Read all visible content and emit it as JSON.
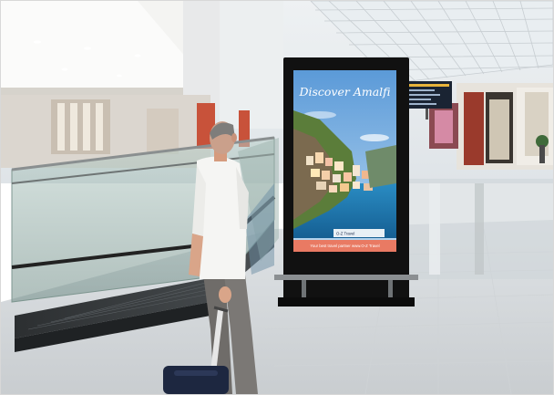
{
  "billboard": {
    "headline": "Discover Amalfi",
    "brand": "O-Z Travel",
    "tagline": "Your best travel partner www.O-Z Travel"
  },
  "colors": {
    "sky": "#6aa6e0",
    "sea": "#1f7fb8",
    "footer_band": "#e97a63",
    "kiosk_frame": "#111111"
  },
  "icons": {
    "departure-board": "airport flight information display"
  }
}
